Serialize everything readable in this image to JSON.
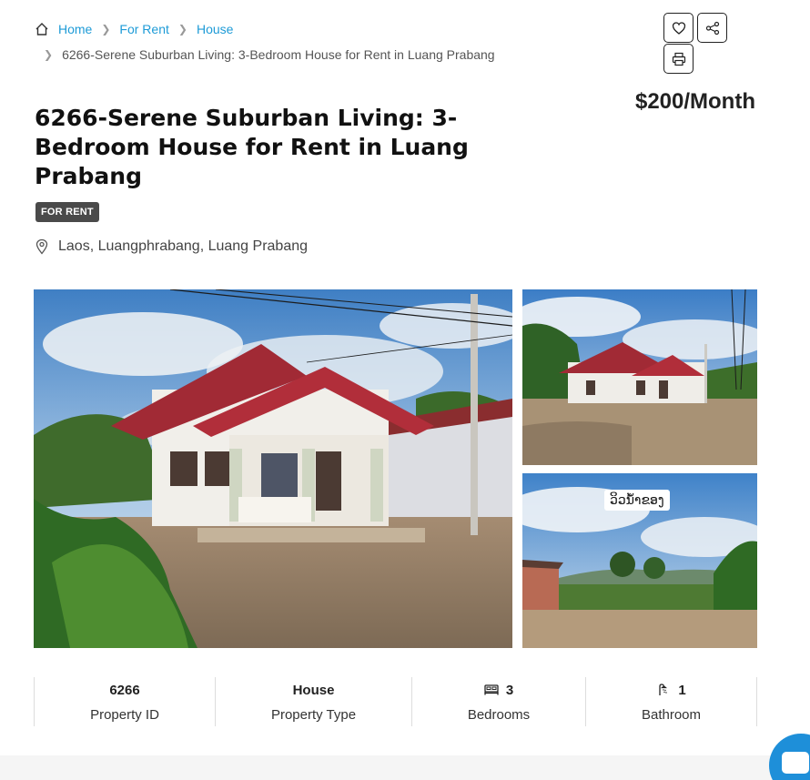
{
  "breadcrumb": {
    "home": "Home",
    "for_rent": "For Rent",
    "house": "House",
    "current": "6266-Serene Suburban Living: 3-Bedroom House for Rent in Luang Prabang"
  },
  "actions": {
    "favorite_icon": "heart-icon",
    "share_icon": "share-icon",
    "print_icon": "print-icon"
  },
  "listing": {
    "title": "6266-Serene Suburban Living: 3-Bedroom House for Rent in Luang Prabang",
    "price": "$200/Month",
    "badge": "FOR RENT",
    "location": "Laos, Luangphrabang, Luang Prabang"
  },
  "photos": {
    "side2_caption": "ວິວນ້ຳຂອງ"
  },
  "stats": [
    {
      "value": "6266",
      "label": "Property ID"
    },
    {
      "value": "House",
      "label": "Property Type"
    },
    {
      "value": "3",
      "label": "Bedrooms",
      "icon": "bed-icon"
    },
    {
      "value": "1",
      "label": "Bathroom",
      "icon": "shower-icon"
    }
  ],
  "colors": {
    "link": "#1e9bd7",
    "badge_bg": "#4a4a4a",
    "chat": "#1e8fd9"
  }
}
